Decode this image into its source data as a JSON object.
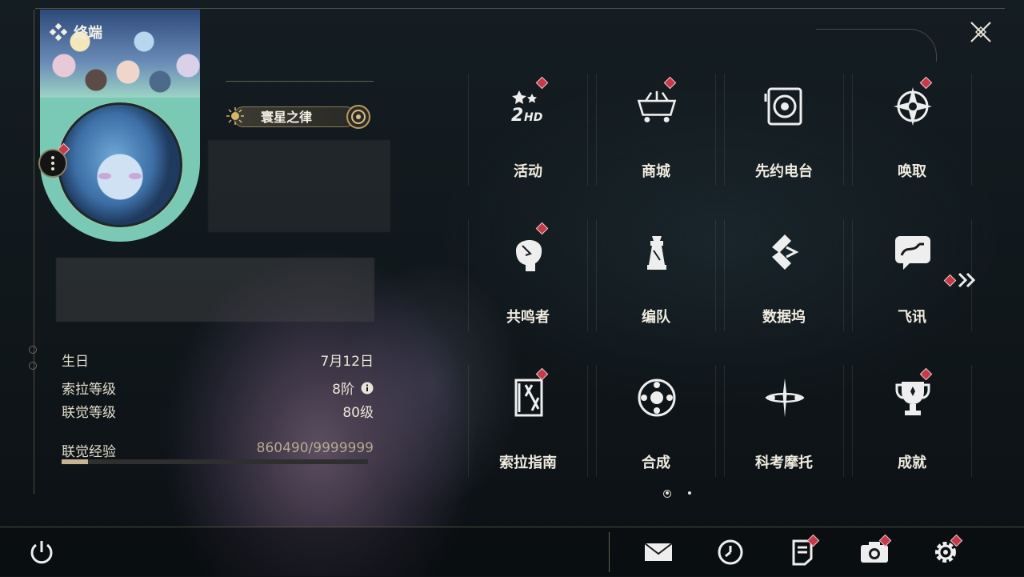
{
  "header": {
    "terminal_label": "终端",
    "close_icon": "close-icon"
  },
  "profile": {
    "title_badge": "寰星之律",
    "info": [
      {
        "key": "生日",
        "value": "7月12日"
      },
      {
        "key": "索拉等级",
        "value": "8阶"
      },
      {
        "key": "联觉等级",
        "value": "80级"
      },
      {
        "key": "联觉经验",
        "value": "860490/9999999"
      }
    ],
    "exp_progress": 0.086
  },
  "menu": {
    "items": [
      {
        "label": "活动",
        "icon": "event-2hd-icon",
        "badge": true
      },
      {
        "label": "商城",
        "icon": "shop-cart-icon",
        "badge": true
      },
      {
        "label": "先约电台",
        "icon": "radio-icon",
        "badge": false
      },
      {
        "label": "唤取",
        "icon": "summon-compass-icon",
        "badge": true
      },
      {
        "label": "共鸣者",
        "icon": "resonator-icon",
        "badge": true
      },
      {
        "label": "编队",
        "icon": "team-chess-icon",
        "badge": false
      },
      {
        "label": "数据坞",
        "icon": "data-bank-icon",
        "badge": false
      },
      {
        "label": "飞讯",
        "icon": "message-chat-icon",
        "badge": false
      },
      {
        "label": "索拉指南",
        "icon": "guide-book-icon",
        "badge": true
      },
      {
        "label": "合成",
        "icon": "synthesis-icon",
        "badge": false
      },
      {
        "label": "科考摩托",
        "icon": "motorcycle-icon",
        "badge": false
      },
      {
        "label": "成就",
        "icon": "achievement-trophy-icon",
        "badge": true
      }
    ],
    "next_page_icon": "double-chevron-right-icon",
    "current_page": 1,
    "total_pages": 2
  },
  "bottom_bar": {
    "power_icon": "power-icon",
    "buttons": [
      {
        "icon": "mail-icon",
        "badge": false
      },
      {
        "icon": "clock-icon",
        "badge": false
      },
      {
        "icon": "notice-icon",
        "badge": true
      },
      {
        "icon": "camera-icon",
        "badge": true
      },
      {
        "icon": "settings-gear-icon",
        "badge": true
      }
    ]
  },
  "colors": {
    "badge_red": "#c43a4a",
    "accent_gold": "#c8b494",
    "background": "#10171b"
  }
}
